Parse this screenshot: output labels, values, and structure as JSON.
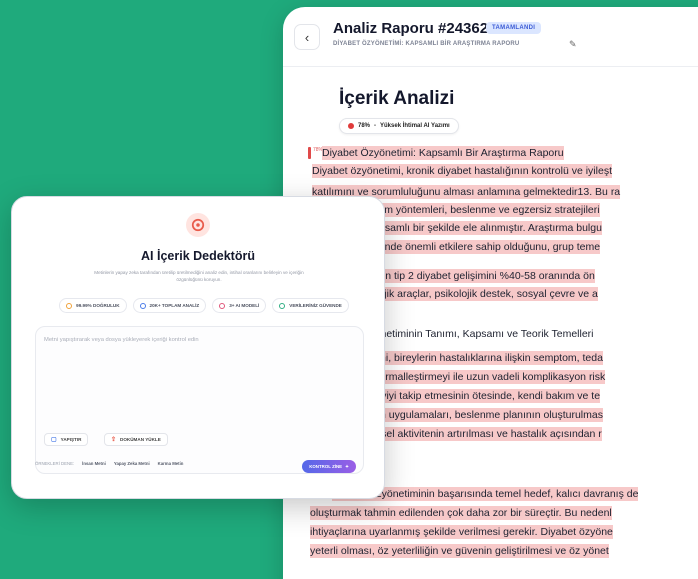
{
  "report": {
    "title": "Analiz Raporu #24362",
    "status_badge": "TAMAMLANDI",
    "subtitle": "DİYABET ÖZYÖNETİMİ: KAPSAMLI BİR ARAŞTIRMA RAPORU",
    "section_title": "İçerik Analizi",
    "probability_percent": "78%",
    "probability_label": "Yüksek İhtimal AI Yazımı",
    "line_percent": "78%",
    "lines": [
      {
        "text": "Diyabet Özyönetimi: Kapsamlı Bir Araştırma Raporu",
        "highlight": true
      },
      {
        "text": "Diyabet özyönetimi, kronik diyabet hastalığının kontrolü ve iyileşt",
        "highlight": true
      },
      {
        "text": "katılımını ve sorumluluğunu alması anlamına gelmektedir13. Bu ra",
        "highlight": true
      },
      {
        "text": "maları, eğitim yöntemleri, beslenme ve egzersiz stratejileri",
        "highlight": true
      },
      {
        "text": "amaları kapsamlı bir şekilde ele alınmıştır. Araştırma bulgu",
        "highlight": true
      },
      {
        "text": "reler üzerinde önemli etkilere sahip olduğunu, grup teme",
        "highlight": true
      },
      {
        "text": "işikliklerinin tip 2 diyabet gelişimini %40-58 oranında ön",
        "highlight": true
      },
      {
        "text": "nda teknolojik araçlar, psikolojik destek, sosyal çevre ve a",
        "highlight": true
      },
      {
        "text": "Özyönetiminin Tanımı, Kapsamı ve Teorik Temelleri",
        "highlight": false
      },
      {
        "text": "özyönetimi, bireylerin hastalıklarına ilişkin semptom, teda",
        "highlight": true
      },
      {
        "text": "üzeyini normalleştirmeyi ile uzun vadeli komplikasyon risk",
        "highlight": true
      },
      {
        "text": "tıbbi tedaviyi takip etmesinin ötesinde, kendi bakım ve te",
        "highlight": true
      },
      {
        "text": "özyönetim uygulamaları, beslenme planının oluşturulmas",
        "highlight": true
      },
      {
        "text": "in ve fiziksel aktivitenin artırılması ve hastalık açısından r",
        "highlight": true
      },
      {
        "text": "edir3.",
        "highlight": true
      },
      {
        "text": "Diyabet özyönetiminin başarısında temel hedef, kalıcı davranış de",
        "highlight": true
      },
      {
        "text": "oluşturmak tahmin edilenden çok daha zor bir süreçtir. Bu nedenl",
        "highlight": true
      },
      {
        "text": "ihtiyaçlarına uyarlanmış şekilde verilmesi gerekir. Diyabet özyöne",
        "highlight": true
      },
      {
        "text": "yeterli olması, öz yeterliliğin ve güvenin geliştirilmesi ve öz yönet",
        "highlight": true
      }
    ]
  },
  "detector": {
    "title": "AI İçerik Dedektörü",
    "description": "Metinlerin yapay zeka tarafından üretilip üretilmediğini analiz edin, intihal oranlarını belirleyin ve içeriğin özgünlüğünü koruyun.",
    "features": [
      {
        "label": "99.99% DOĞRULUK",
        "color": "#f0a23a"
      },
      {
        "label": "20K+ TOPLAM ANALİZ",
        "color": "#4a7be8"
      },
      {
        "label": "3+ AI MODELİ",
        "color": "#e0567a"
      },
      {
        "label": "VERİLERİNİZ GÜVENDE",
        "color": "#2fae84"
      }
    ],
    "placeholder": "Metni yapıştırarak veya dosya yükleyerek içeriği kontrol edin",
    "paste_button": "YAPIŞTIR",
    "upload_button": "DOKÜMAN YÜKLE",
    "examples_label": "ÖRNEKLERİ DENE:",
    "examples": [
      "İnsan Metni",
      "Yapay Zeka Metni",
      "Karma Metin"
    ],
    "check_button": "KONTROL ZİNE"
  }
}
